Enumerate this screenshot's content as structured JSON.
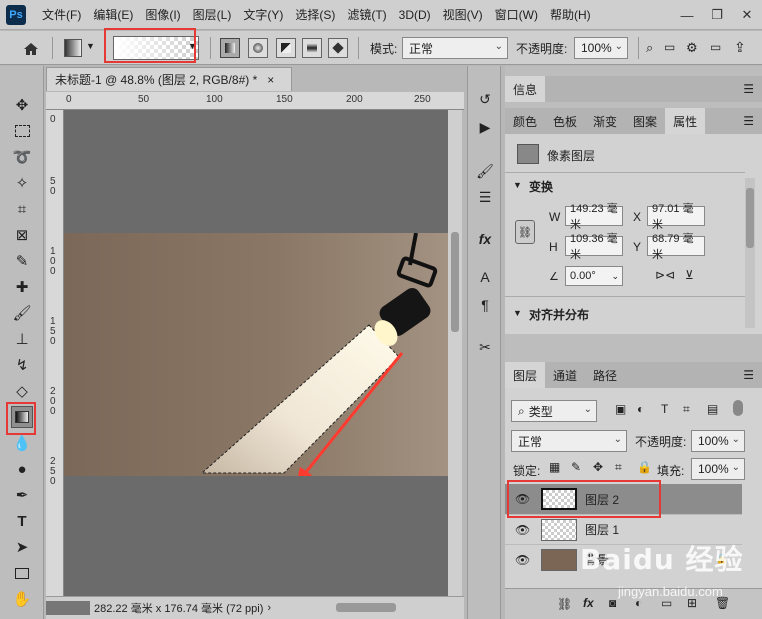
{
  "app": {
    "logo_text": "Ps"
  },
  "menu": [
    "文件(F)",
    "编辑(E)",
    "图像(I)",
    "图层(L)",
    "文字(Y)",
    "选择(S)",
    "滤镜(T)",
    "3D(D)",
    "视图(V)",
    "窗口(W)",
    "帮助(H)"
  ],
  "window_controls": {
    "minimize": "—",
    "restore": "❐",
    "close": "✕"
  },
  "options": {
    "mode_label": "模式:",
    "mode_value": "正常",
    "opacity_label": "不透明度:",
    "opacity_value": "100%"
  },
  "document": {
    "tab_title": "未标题-1 @ 48.8% (图层 2, RGB/8#) *",
    "close_glyph": "×",
    "ruler_ticks": [
      "0",
      "50",
      "100",
      "150",
      "200",
      "250"
    ],
    "ruler_left_ticks": [
      "0",
      "5",
      "0",
      "1",
      "0",
      "0",
      "1",
      "5",
      "0",
      "2",
      "0",
      "0",
      "2",
      "5",
      "0"
    ],
    "status_text": "282.22 毫米 x 176.74 毫米 (72 ppi)"
  },
  "info_panel": {
    "tab": "信息"
  },
  "properties_panel": {
    "tabs": [
      "颜色",
      "色板",
      "渐变",
      "图案",
      "属性"
    ],
    "active_tab": "属性",
    "layer_type": "像素图层",
    "transform_title": "变换",
    "w_label": "W",
    "w_value": "149.23 毫米",
    "x_label": "X",
    "x_value": "97.01 毫米",
    "h_label": "H",
    "h_value": "109.36 毫米",
    "y_label": "Y",
    "y_value": "68.79 毫米",
    "angle_value": "0.00°",
    "align_title": "对齐并分布"
  },
  "layers_panel": {
    "tabs": [
      "图层",
      "通道",
      "路径"
    ],
    "active_tab": "图层",
    "filter_kind": "类型",
    "blend_mode": "正常",
    "opacity_label": "不透明度:",
    "opacity_value": "100%",
    "lock_label": "锁定:",
    "fill_label": "填充:",
    "fill_value": "100%",
    "layers": [
      {
        "name": "图层 2",
        "selected": true
      },
      {
        "name": "图层 1",
        "selected": false
      },
      {
        "name": "背景",
        "selected": false
      }
    ]
  },
  "watermark": {
    "brand": "Baidu 经验",
    "url": "jingyan.baidu.com"
  },
  "colors": {
    "highlight_red": "#e53935",
    "arrow_red": "#ff3b30",
    "selected_layer": "#8c8c8c"
  }
}
